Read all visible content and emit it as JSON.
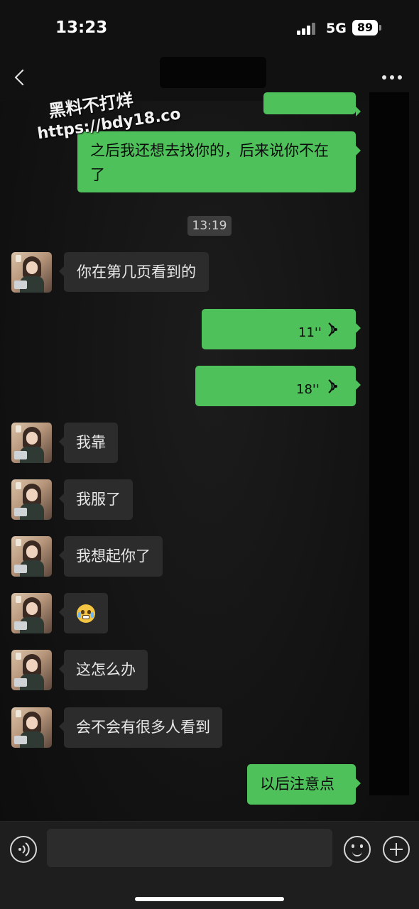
{
  "status_bar": {
    "time": "13:23",
    "network": "5G",
    "battery": "89"
  },
  "nav": {
    "back_icon": "chevron-left",
    "more_icon": "ellipsis-horizontal"
  },
  "watermark": {
    "line1": "黑料不打烊",
    "line2": "https://bdy18.co"
  },
  "messages": {
    "me_1": "之后我还想去找你的，后来说你不在了",
    "timestamp": "13:19",
    "other_1": "你在第几页看到的",
    "voice_1_duration": "11''",
    "voice_2_duration": "18''",
    "other_2": "我靠",
    "other_3": "我服了",
    "other_4": "我想起你了",
    "other_5_emoji": "worried-face-emoji",
    "other_6": "这怎么办",
    "other_7": "会不会有很多人看到",
    "me_2": "以后注意点"
  },
  "colors": {
    "my_bubble": "#4ec15a",
    "their_bubble": "#2c2c2c",
    "background": "#111111"
  },
  "input_bar": {
    "placeholder": ""
  }
}
